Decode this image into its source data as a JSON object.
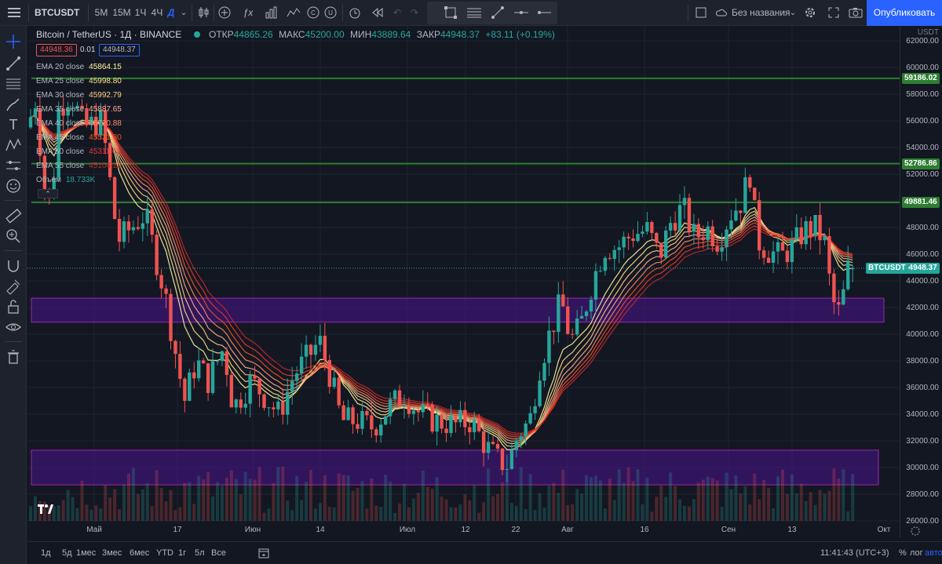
{
  "toolbar": {
    "menu_icon": "hamburger-icon",
    "symbol": "BTCUSDT",
    "intervals": [
      "5М",
      "15М",
      "1Ч",
      "4Ч",
      "Д"
    ],
    "active_interval": "Д",
    "layout_name": "Без названия",
    "publish_label": "Опубликовать"
  },
  "legend": {
    "title": "Bitcoin / TetherUS · 1Д · BINANCE",
    "open_label": "ОТКР",
    "open_value": "44865.26",
    "high_label": "МАКС",
    "high_value": "45200.00",
    "low_label": "МИН",
    "low_value": "43889.64",
    "close_label": "ЗАКР",
    "close_value": "44948.37",
    "change": "+83.11 (+0.19%)",
    "bid": "44948.36",
    "spread": "0.01",
    "ask": "44948.37",
    "emas": [
      {
        "label": "EMA 20 close",
        "value": "45864.15",
        "color": "#fff59d"
      },
      {
        "label": "EMA 25 close",
        "value": "45998.80",
        "color": "#ffe082"
      },
      {
        "label": "EMA 30 close",
        "value": "45992.79",
        "color": "#ffcc80"
      },
      {
        "label": "EMA 35 close",
        "value": "45887.65",
        "color": "#ffab91"
      },
      {
        "label": "EMA 40 close",
        "value": "45720.88",
        "color": "#ff8a65"
      },
      {
        "label": "EMA 45 close",
        "value": "45521.80",
        "color": "#f4511e"
      },
      {
        "label": "EMA 50 close",
        "value": "45311.63",
        "color": "#e53935"
      },
      {
        "label": "EMA 55 close",
        "value": "45104.25",
        "color": "#c62828"
      }
    ],
    "volume_label": "Объём",
    "volume_value": "18.733K"
  },
  "price_axis": {
    "currency": "USDT",
    "labels": [
      "62000.00",
      "60000.00",
      "58000.00",
      "56000.00",
      "54000.00",
      "52000.00",
      "50000.00",
      "48000.00",
      "46000.00",
      "44000.00",
      "42000.00",
      "40000.00",
      "38000.00",
      "36000.00",
      "34000.00",
      "32000.00",
      "30000.00",
      "28000.00",
      "26000.00"
    ],
    "level_59186": "59186.02",
    "level_52786": "52786.86",
    "level_49881": "49881.46",
    "last_symbol": "BTCUSDT",
    "last_price": "44948.37"
  },
  "time_axis": {
    "labels": [
      "Май",
      "17",
      "Июн",
      "14",
      "Июл",
      "12",
      "22",
      "Авг",
      "16",
      "Сен",
      "13",
      "Окт"
    ]
  },
  "bottom": {
    "ranges": [
      "1д",
      "5д",
      "1мес",
      "3мес",
      "6мес",
      "YTD",
      "1г",
      "5л",
      "Все"
    ],
    "time": "11:41:43 (UTC+3)",
    "percent": "%",
    "log": "лог",
    "auto": "авто"
  },
  "colors": {
    "up": "#26a69a",
    "down": "#ef5350",
    "level": "#2e7d32",
    "zone": "#7b1fa2",
    "accent": "#2962ff"
  },
  "chart_data": {
    "type": "candlestick",
    "zones": [
      [
        40900,
        42700
      ],
      [
        28700,
        31300
      ]
    ],
    "levels": [
      59186.02,
      52786.86,
      49881.46
    ],
    "ylim": [
      25500,
      63000
    ]
  }
}
